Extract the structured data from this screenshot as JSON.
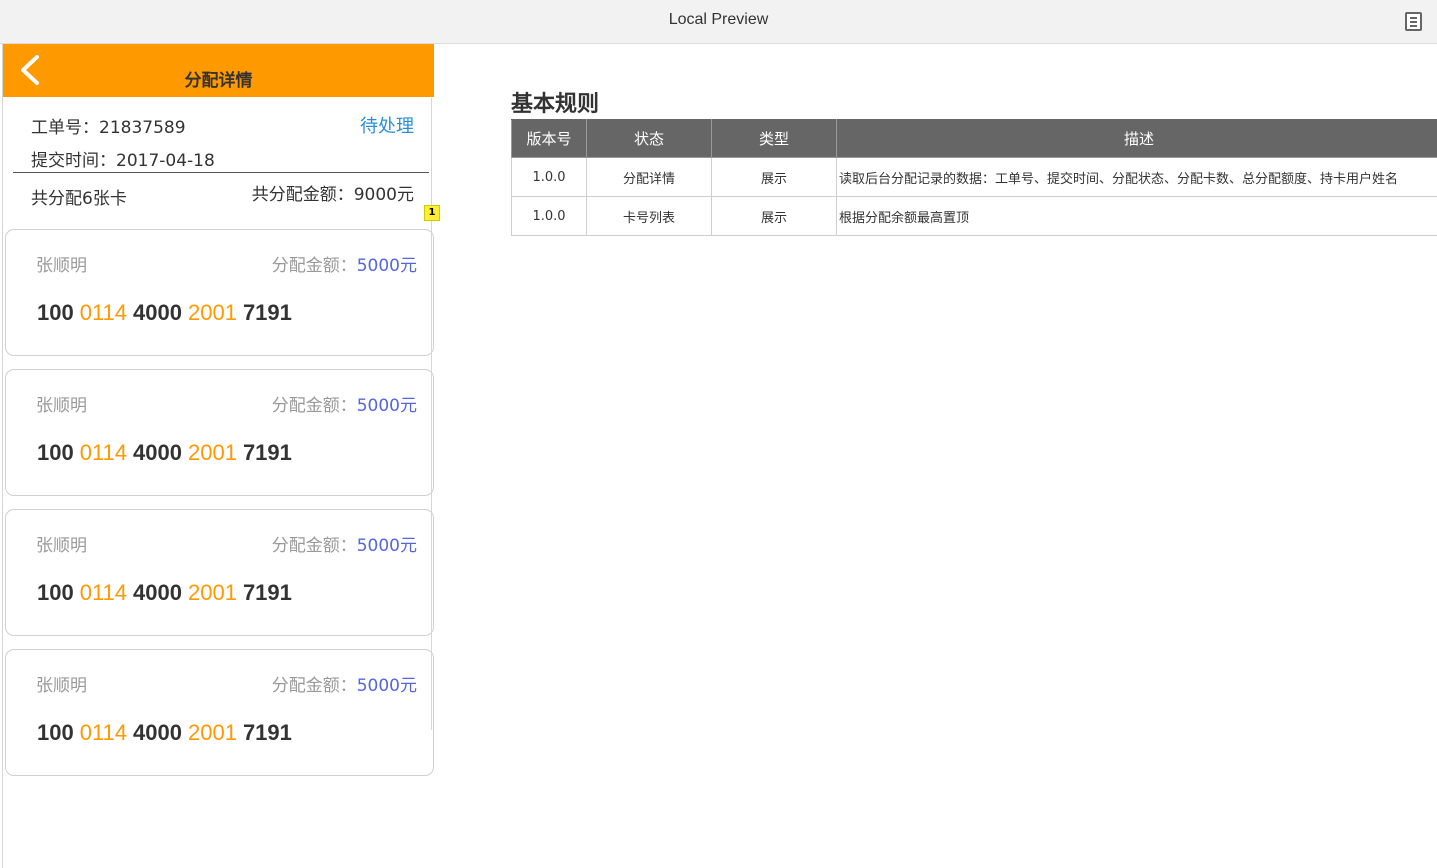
{
  "window": {
    "title": "Local Preview",
    "menu_icon": "document-list-icon"
  },
  "navbar": {
    "back_icon": "chevron-left-icon",
    "title": "分配详情"
  },
  "summary": {
    "order_no": "工单号：21837589",
    "status": "待处理",
    "submit_time": "提交时间：2017-04-18",
    "card_count": "共分配6张卡",
    "total_amount": "共分配金额：9000元"
  },
  "badge": "1",
  "cards": [
    {
      "holder": "张顺明",
      "amount_label": "分配金额：",
      "amount_value": "5000元",
      "number": [
        "100",
        "0114",
        "4000",
        "2001",
        "7191"
      ]
    },
    {
      "holder": "张顺明",
      "amount_label": "分配金额：",
      "amount_value": "5000元",
      "number": [
        "100",
        "0114",
        "4000",
        "2001",
        "7191"
      ]
    },
    {
      "holder": "张顺明",
      "amount_label": "分配金额：",
      "amount_value": "5000元",
      "number": [
        "100",
        "0114",
        "4000",
        "2001",
        "7191"
      ]
    },
    {
      "holder": "张顺明",
      "amount_label": "分配金额：",
      "amount_value": "5000元",
      "number": [
        "100",
        "0114",
        "4000",
        "2001",
        "7191"
      ]
    }
  ],
  "rules": {
    "title": "基本规则",
    "headers": [
      "版本号",
      "状态",
      "类型",
      "描述"
    ],
    "rows": [
      [
        "1.0.0",
        "分配详情",
        "展示",
        "读取后台分配记录的数据：工单号、提交时间、分配状态、分配卡数、总分配额度、持卡用户姓名"
      ],
      [
        "1.0.0",
        "卡号列表",
        "展示",
        "根据分配余额最高置顶"
      ]
    ]
  },
  "colors": {
    "accent": "#ff9900",
    "link": "#2a8fd6",
    "amount": "#5566dd",
    "header_bg": "#666666"
  }
}
